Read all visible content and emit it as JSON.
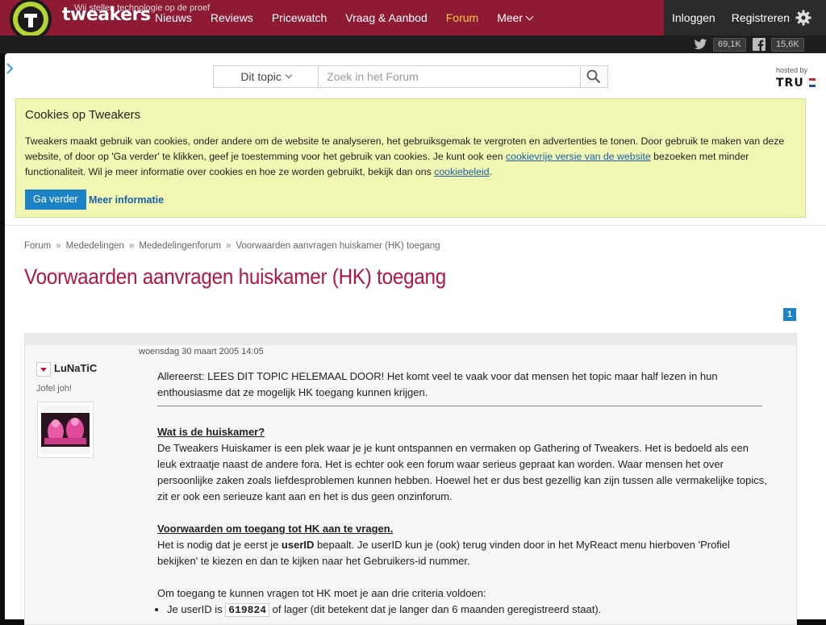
{
  "header": {
    "brand": "tweakers",
    "tagline": "Wij stellen technologie op de proef",
    "nav": [
      {
        "label": "Nieuws"
      },
      {
        "label": "Reviews"
      },
      {
        "label": "Pricewatch"
      },
      {
        "label": "Vraag & Aanbod"
      },
      {
        "label": "Forum",
        "active": true
      },
      {
        "label": "Meer"
      }
    ],
    "auth": {
      "login": "Inloggen",
      "register": "Registreren"
    },
    "social": {
      "twitter_count": "69,1K",
      "facebook_count": "15,6K"
    }
  },
  "search": {
    "scope": "Dit topic",
    "placeholder": "Zoek in het Forum"
  },
  "hosting": {
    "label": "hosted by",
    "name": "TRU"
  },
  "cookie": {
    "title": "Cookies op Tweakers",
    "text_before": "Tweakers maakt gebruik van cookies, onder andere om de website te analyseren, het gebruiksgemak te vergroten en advertenties te tonen. Door gebruik te maken van deze website, of door op 'Ga verder' te klikken, geef je toestemming voor het gebruik van cookies. Je kunt ook een ",
    "link1": "cookievrije versie van de website",
    "text_middle": " bezoeken met minder functionaliteit. Wil je meer informatie over cookies en hoe ze worden gebruikt, bekijk dan ons ",
    "link2": "cookiebeleid",
    "text_after": ".",
    "accept": "Ga verder",
    "more": "Meer informatie"
  },
  "breadcrumb": [
    "Forum",
    "Mededelingen",
    "Mededelingenforum",
    "Voorwaarden aanvragen huiskamer (HK) toegang"
  ],
  "page_title": "Voorwaarden aanvragen huiskamer (HK) toegang",
  "pagination": {
    "current": "1"
  },
  "post": {
    "date": "woensdag 30 maart 2005 14:05",
    "author": "LuNaTiC",
    "author_title": "Jofel joh!",
    "intro": "Allereerst: LEES DIT TOPIC HELEMAAL DOOR! Het komt veel te vaak voor dat mensen het topic maar half lezen in hun enthousiasme dat ze mogelijk HK toegang kunnen krijgen.",
    "h1": "Wat is de huiskamer?",
    "p1": "De Tweakers Huiskamer is een plek waar je je kunt ontspannen en vermaken op Gathering of Tweakers. Het is bedoeld als een leuk extraatje naast de andere fora. Het is echter ook een forum waar serieus gepraat kan worden. Waar mensen het over persoonlijke zaken zoals liefdesproblemen kunnen hebben. Hoewel het er dus best gezellig kan zijn tussen alle vermakelijke topics, zit er ook een serieuze kant aan en het is dus geen onzinforum.",
    "h2": "Voorwaarden om toegang tot HK aan te vragen.",
    "p2_before": "Het is nodig dat je eerst je ",
    "p2_bold": "userID",
    "p2_after": " bepaalt. Je userID kun je (ook) terug vinden door in het MyReact menu hierboven 'Profiel bekijken' te kiezen en dan te kijken naar het Gebruikers-id nummer.",
    "p3": "Om toegang te kunnen vragen tot HK moet je aan drie criteria voldoen:",
    "li1_before": "Je userID is ",
    "li1_code": "619824",
    "li1_after": " of lager (dit betekent dat je langer dan 6 maanden geregistreerd staat)."
  },
  "colors": {
    "header_bg": "#8e1a33",
    "accent_red": "#b3173f",
    "link_blue": "#1a5fa8",
    "button_blue": "#1a82c5",
    "cookie_bg": "#f1f6b2",
    "active_nav": "#f7c94a"
  }
}
